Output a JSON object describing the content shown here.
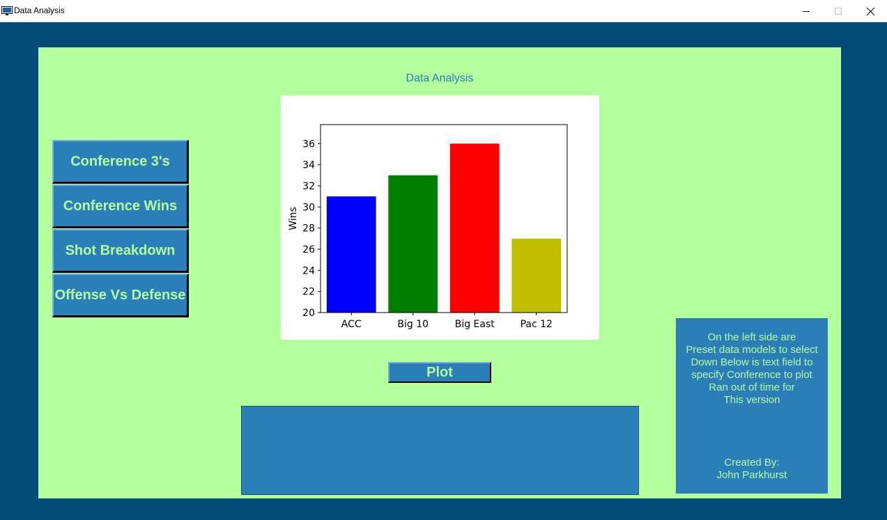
{
  "window": {
    "title": "Data Analysis"
  },
  "heading": "Data Analysis",
  "side_buttons": [
    {
      "label": "Conference 3's"
    },
    {
      "label": "Conference Wins"
    },
    {
      "label": "Shot Breakdown"
    },
    {
      "label": "Offense Vs Defense"
    }
  ],
  "plot_button": "Plot",
  "conference_input": {
    "value": ""
  },
  "info": {
    "lines": [
      "On the left side are",
      "Preset data models to select",
      "Down Below is text field to",
      "specify Conference to plot",
      "Ran out of time for",
      "This version"
    ],
    "credit_lines": [
      "Created By:",
      "John Parkhurst"
    ]
  },
  "colors": {
    "background": "#034b78",
    "panel": "#b4fe9d",
    "accent": "#2b7eb8"
  },
  "chart_data": {
    "type": "bar",
    "categories": [
      "ACC",
      "Big 10",
      "Big East",
      "Pac 12"
    ],
    "values": [
      31,
      33,
      36,
      27
    ],
    "colors": [
      "#0000ff",
      "#008000",
      "#ff0000",
      "#bfbf00"
    ],
    "ylabel": "Wins",
    "ylim": [
      20,
      37.8
    ],
    "yticks": [
      20,
      22,
      24,
      26,
      28,
      30,
      32,
      34,
      36
    ]
  }
}
